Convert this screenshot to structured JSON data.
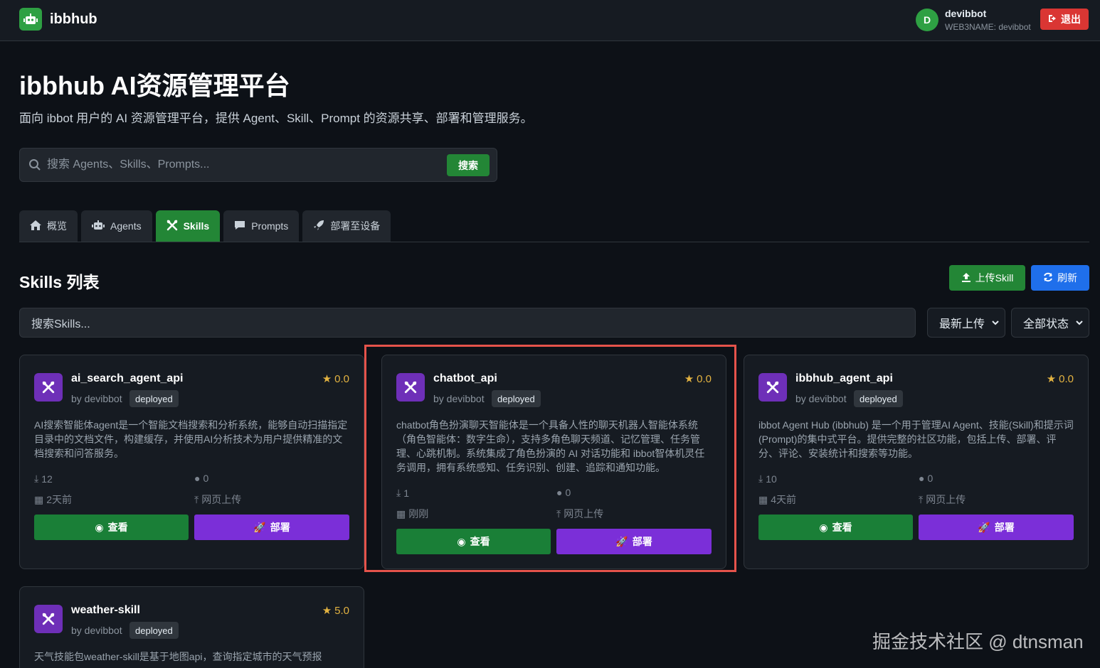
{
  "app": {
    "brand": "ibbhub"
  },
  "user": {
    "initial": "D",
    "name": "devibbot",
    "subtitle": "WEB3NAME: devibbot",
    "logout_label": "退出"
  },
  "hero": {
    "title": "ibbhub AI资源管理平台",
    "description": "面向 ibbot 用户的 AI 资源管理平台，提供 Agent、Skill、Prompt 的资源共享、部署和管理服务。"
  },
  "search": {
    "placeholder": "搜索 Agents、Skills、Prompts...",
    "button": "搜索"
  },
  "tabs": [
    {
      "label": "概览",
      "icon": "home-icon"
    },
    {
      "label": "Agents",
      "icon": "robot-icon"
    },
    {
      "label": "Skills",
      "icon": "tools-icon",
      "active": true
    },
    {
      "label": "Prompts",
      "icon": "comment-icon"
    },
    {
      "label": "部署至设备",
      "icon": "rocket-icon"
    }
  ],
  "section": {
    "title": "Skills 列表",
    "upload_label": "上传Skill",
    "refresh_label": "刷新"
  },
  "filter": {
    "placeholder": "搜索Skills...",
    "sort_selected": "最新上传",
    "status_selected": "全部状态"
  },
  "skills": [
    {
      "name": "ai_search_agent_api",
      "author": "by devibbot",
      "status": "deployed",
      "rating": "0.0",
      "description": "AI搜索智能体agent是一个智能文档搜索和分析系统，能够自动扫描指定目录中的文档文件，构建缓存，并使用AI分析技术为用户提供精准的文档搜索和问答服务。",
      "downloads": "12",
      "comments": "0",
      "time": "2天前",
      "source": "网页上传",
      "view_label": "查看",
      "deploy_label": "部署"
    },
    {
      "name": "chatbot_api",
      "author": "by devibbot",
      "status": "deployed",
      "rating": "0.0",
      "description": "chatbot角色扮演聊天智能体是一个具备人性的聊天机器人智能体系统（角色智能体：数字生命），支持多角色聊天频道、记忆管理、任务管理、心跳机制。系统集成了角色扮演的 AI 对话功能和 ibbot智体机灵任务调用，拥有系统感知、任务识别、创建、追踪和通知功能。",
      "downloads": "1",
      "comments": "0",
      "time": "刚刚",
      "source": "网页上传",
      "view_label": "查看",
      "deploy_label": "部署"
    },
    {
      "name": "ibbhub_agent_api",
      "author": "by devibbot",
      "status": "deployed",
      "rating": "0.0",
      "description": "ibbot Agent Hub (ibbhub) 是一个用于管理AI Agent、技能(Skill)和提示词(Prompt)的集中式平台。提供完整的社区功能，包括上传、部署、评分、评论、安装统计和搜索等功能。",
      "downloads": "10",
      "comments": "0",
      "time": "4天前",
      "source": "网页上传",
      "view_label": "查看",
      "deploy_label": "部署"
    },
    {
      "name": "weather-skill",
      "author": "by devibbot",
      "status": "deployed",
      "rating": "5.0",
      "description": "天气技能包weather-skill是基于地图api，查询指定城市的天气预报"
    }
  ],
  "watermark": "掘金技术社区 @ dtnsman"
}
